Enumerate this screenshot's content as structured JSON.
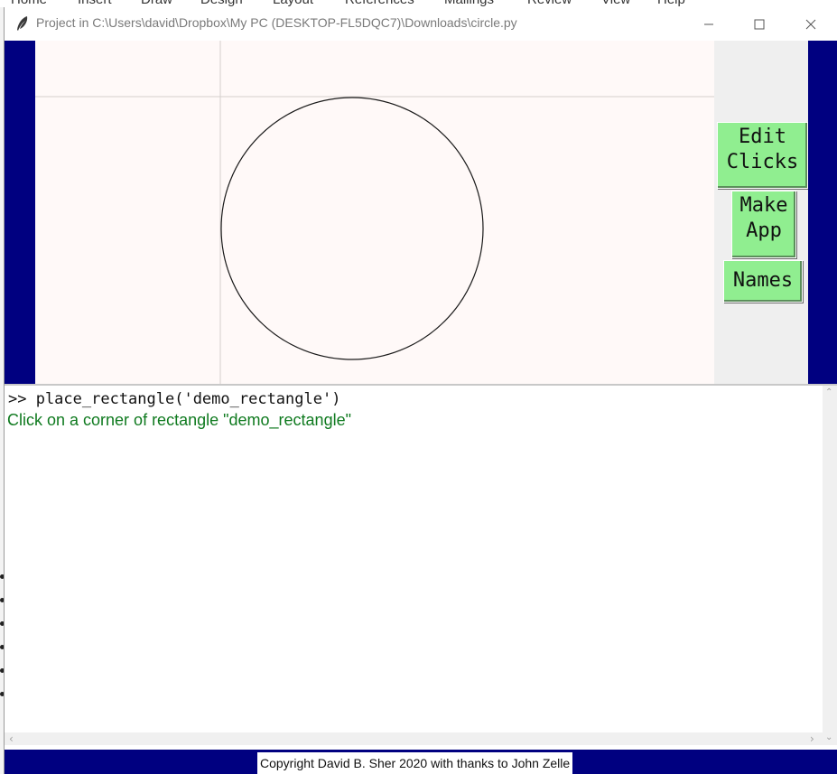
{
  "background_app": {
    "ribbon_tabs": [
      "Home",
      "Insert",
      "Draw",
      "Design",
      "Layout",
      "References",
      "Mailings",
      "Review",
      "View",
      "Help"
    ]
  },
  "window": {
    "title": "Project in C:\\Users\\david\\Dropbox\\My PC (DESKTOP-FL5DQC7)\\Downloads\\circle.py",
    "app_icon": "feather-icon",
    "controls": {
      "minimize_icon": "minimize-icon",
      "maximize_icon": "maximize-icon",
      "close_icon": "close-icon"
    }
  },
  "canvas": {
    "background_color": "#fff9f8",
    "shapes": [
      {
        "type": "circle",
        "name": "circle"
      }
    ]
  },
  "buttons": {
    "edit_clicks": {
      "line1": "Edit",
      "line2": "Clicks"
    },
    "make_app": {
      "line1": "Make",
      "line2": "App"
    },
    "names": {
      "label": "Names"
    },
    "color": "#90ee90"
  },
  "console": {
    "prompt": ">> place_rectangle('demo_rectangle')",
    "message": "Click on a corner of rectangle \"demo_rectangle\"",
    "message_color": "#0f7a1f"
  },
  "footer": {
    "copyright": "Copyright David B. Sher 2020 with thanks to John Zelle",
    "frame_color": "#000080"
  }
}
